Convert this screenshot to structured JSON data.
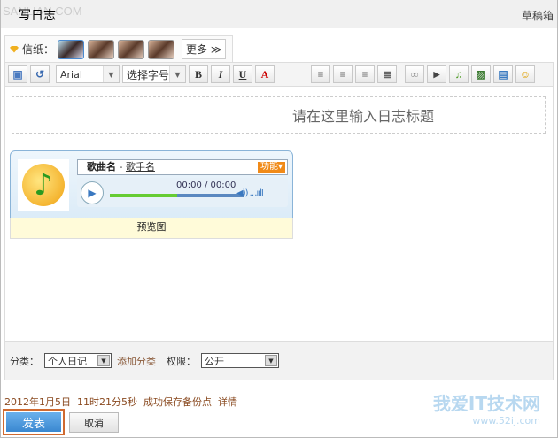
{
  "header": {
    "title": "写日志",
    "watermark": "SANLIAN.COM",
    "drafts": "草稿箱"
  },
  "stationery": {
    "label": "信纸：",
    "more": "更多 ≫",
    "thumbs": 4
  },
  "toolbar": {
    "font": "Arial",
    "size": "选择字号",
    "bold": "B",
    "italic": "I",
    "underline": "U",
    "color": "A"
  },
  "editor": {
    "title_placeholder": "请在这里输入日志标题"
  },
  "player": {
    "song": "歌曲名",
    "separator": " - ",
    "artist": "歌手名",
    "function": "功能▾",
    "time": "00:00 / 00:00",
    "progress": 0.5,
    "preview": "预览图"
  },
  "bottom": {
    "category_label": "分类：",
    "category": "个人日记",
    "add_category": "添加分类",
    "permission_label": "权限：",
    "permission": "公开"
  },
  "status": {
    "date": "2012年1月5日",
    "time": "11时21分5秒",
    "message": "成功保存备份点",
    "details": "详情"
  },
  "buttons": {
    "publish": "发表",
    "cancel": "取消"
  },
  "watermark": {
    "text": "我爱IT技术网",
    "url": "www.52ij.com"
  }
}
